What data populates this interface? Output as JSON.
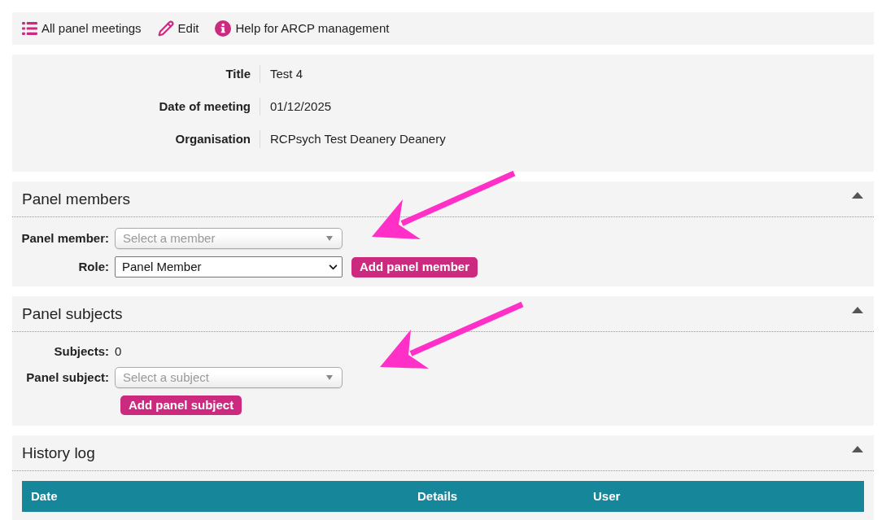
{
  "toolbar": [
    {
      "kind": "list",
      "label": "All panel meetings"
    },
    {
      "kind": "edit",
      "label": "Edit"
    },
    {
      "kind": "info",
      "label": "Help for ARCP management"
    }
  ],
  "details": [
    {
      "label": "Title",
      "value": "Test 4"
    },
    {
      "label": "Date of meeting",
      "value": "01/12/2025"
    },
    {
      "label": "Organisation",
      "value": "RCPsych Test Deanery Deanery"
    }
  ],
  "panel_members": {
    "title": "Panel members",
    "expanded": true,
    "member_field": {
      "label": "Panel member:",
      "placeholder": "Select a member"
    },
    "role_field": {
      "label": "Role:",
      "value": "Panel Member"
    },
    "add_button": "Add panel member"
  },
  "panel_subjects": {
    "title": "Panel subjects",
    "expanded": true,
    "subjects": {
      "label": "Subjects:",
      "value": "0"
    },
    "subject_field": {
      "label": "Panel subject:",
      "placeholder": "Select a subject"
    },
    "add_button": "Add panel subject"
  },
  "history_log": {
    "title": "History log",
    "expanded": true,
    "columns": [
      "Date",
      "Details",
      "User"
    ]
  }
}
